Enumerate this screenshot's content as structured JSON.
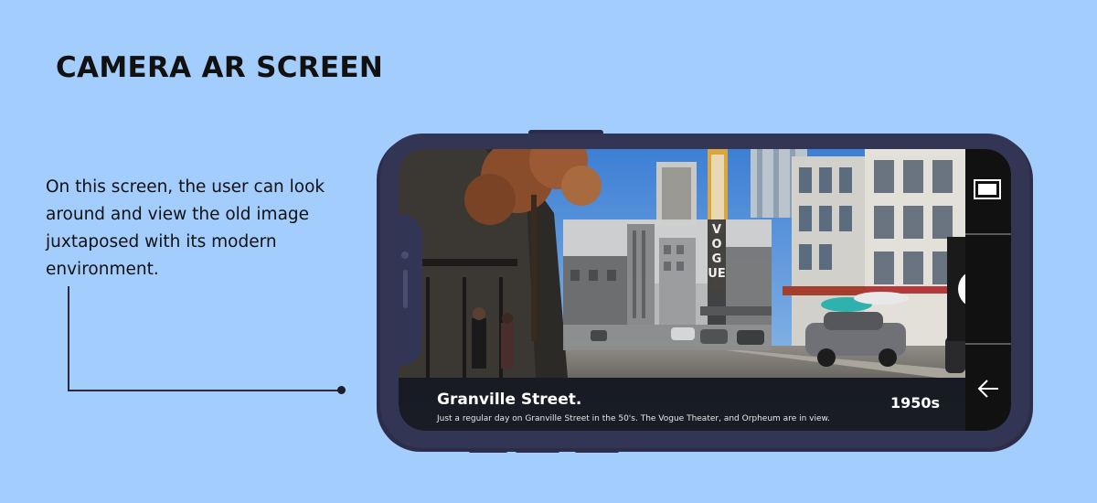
{
  "heading": "CAMERA AR SCREEN",
  "description": "On this screen, the user can look around and view the old image juxtaposed with its modern environment.",
  "ar_view": {
    "location_title": "Granville Street.",
    "location_caption": "Just a regular day on Granville Street in the 50's. The Vogue Theater, and Orpheum are in view.",
    "era": "1950s",
    "sign_letters": "VOGUE"
  },
  "controls": {
    "frame_icon": "frame-toggle-icon",
    "shutter_icon": "shutter-button-icon",
    "back_icon": "arrow-left-icon"
  },
  "colors": {
    "background": "#a3cdfd",
    "phone_body": "#333554",
    "caption_bar": "#0f0f14"
  }
}
